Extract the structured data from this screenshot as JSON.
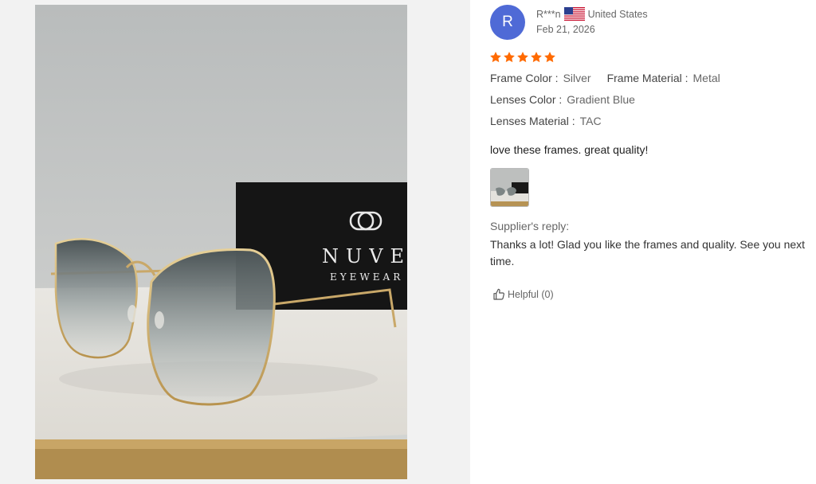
{
  "review": {
    "avatar_initial": "R",
    "reviewer_name": "R***n",
    "country": "United States",
    "date": "Feb 21, 2026",
    "rating": 5,
    "attributes": {
      "frame_color_label": "Frame Color :",
      "frame_color_value": "Silver",
      "frame_material_label": "Frame Material :",
      "frame_material_value": "Metal",
      "lenses_color_label": "Lenses Color :",
      "lenses_color_value": "Gradient Blue",
      "lenses_material_label": "Lenses Material :",
      "lenses_material_value": "TAC"
    },
    "comment": "love these frames. great quality!",
    "supplier_reply_label": "Supplier's reply:",
    "supplier_reply": "Thanks a lot! Glad you like the frames and quality. See you next time.",
    "helpful_label": "Helpful (0)"
  },
  "photo": {
    "brand_text": "NUVE",
    "brand_sub": "EYEWEAR"
  },
  "colors": {
    "star": "#ff6a00",
    "avatar": "#4f6ad6"
  },
  "icons": [
    "us-flag-icon",
    "star-icon",
    "thumbs-up-icon"
  ]
}
